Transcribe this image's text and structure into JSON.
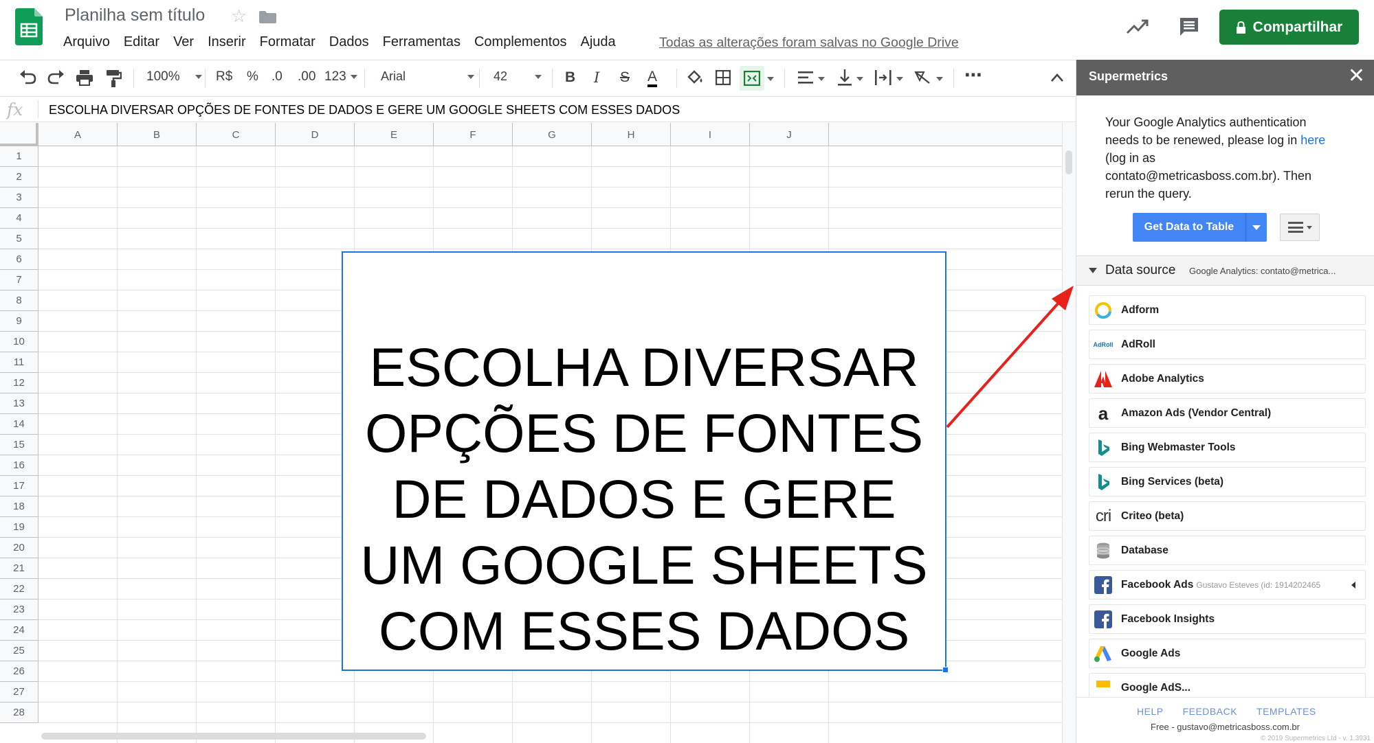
{
  "header": {
    "doc_title": "Planilha sem título",
    "menu": [
      "Arquivo",
      "Editar",
      "Ver",
      "Inserir",
      "Formatar",
      "Dados",
      "Ferramentas",
      "Complementos",
      "Ajuda"
    ],
    "save_status": "Todas as alterações foram salvas no Google Drive",
    "share_label": "Compartilhar",
    "brand_color": "#188038"
  },
  "toolbar": {
    "zoom": "100%",
    "currency": "R$",
    "percent": "%",
    "decrease_decimal": ".0",
    "increase_decimal": ".00",
    "number_format": "123",
    "font": "Arial",
    "font_size": "42",
    "bold": "B",
    "italic": "I",
    "strike": "S",
    "text_color": "A",
    "more": "⋯"
  },
  "formula_bar": {
    "fx": "fx",
    "value": "ESCOLHA DIVERSAR OPÇÕES DE FONTES DE DADOS E GERE UM GOOGLE SHEETS COM ESSES DADOS"
  },
  "grid": {
    "columns": [
      "A",
      "B",
      "C",
      "D",
      "E",
      "F",
      "G",
      "H",
      "I",
      "J"
    ],
    "rows": [
      "1",
      "2",
      "3",
      "4",
      "5",
      "6",
      "7",
      "8",
      "9",
      "10",
      "11",
      "12",
      "13",
      "14",
      "15",
      "16",
      "17",
      "18",
      "19",
      "20",
      "21",
      "22",
      "23",
      "24",
      "25",
      "26",
      "27",
      "28"
    ],
    "merged_cell_text": "ESCOLHA DIVERSAR OPÇÕES DE FONTES DE DADOS E GERE UM GOOGLE SHEETS COM ESSES DADOS"
  },
  "sidebar": {
    "title": "Supermetrics",
    "close": "✕",
    "auth_before": "Your Google Analytics authentication needs to be renewed, please log in ",
    "auth_link": "here",
    "auth_after": " (log in as contato@metricasboss.com.br). Then rerun the query.",
    "get_data_label": "Get Data to Table",
    "datasource_label": "Data source",
    "datasource_value": "Google Analytics: contato@metrica...",
    "sources": [
      {
        "name": "Adform",
        "icon": "adform-icon",
        "extra": ""
      },
      {
        "name": "AdRoll",
        "icon": "adroll-icon",
        "extra": ""
      },
      {
        "name": "Adobe Analytics",
        "icon": "adobe-icon",
        "extra": ""
      },
      {
        "name": "Amazon Ads (Vendor Central)",
        "icon": "amazon-icon",
        "extra": ""
      },
      {
        "name": "Bing Webmaster Tools",
        "icon": "bing-icon",
        "extra": ""
      },
      {
        "name": "Bing Services (beta)",
        "icon": "bing-icon",
        "extra": ""
      },
      {
        "name": "Criteo (beta)",
        "icon": "criteo-icon",
        "extra": ""
      },
      {
        "name": "Database",
        "icon": "database-icon",
        "extra": ""
      },
      {
        "name": "Facebook Ads",
        "icon": "facebook-icon",
        "extra": "Gustavo Esteves (id: 1914202465"
      },
      {
        "name": "Facebook Insights",
        "icon": "facebook-icon",
        "extra": ""
      },
      {
        "name": "Google Ads",
        "icon": "google-ads-icon",
        "extra": ""
      },
      {
        "name": "Google AdS...",
        "icon": "google-adsense-icon",
        "extra": ""
      }
    ],
    "adroll_logo_text": "AdRoll",
    "criteo_logo_text": "cri",
    "amazon_logo_text": "a",
    "footer_links": [
      "HELP",
      "FEEDBACK",
      "TEMPLATES"
    ],
    "footer_user": "Free - gustavo@metricasboss.com.br",
    "footer_copy": "© 2019 Supermetrics Ltd - v. 1.3931"
  }
}
